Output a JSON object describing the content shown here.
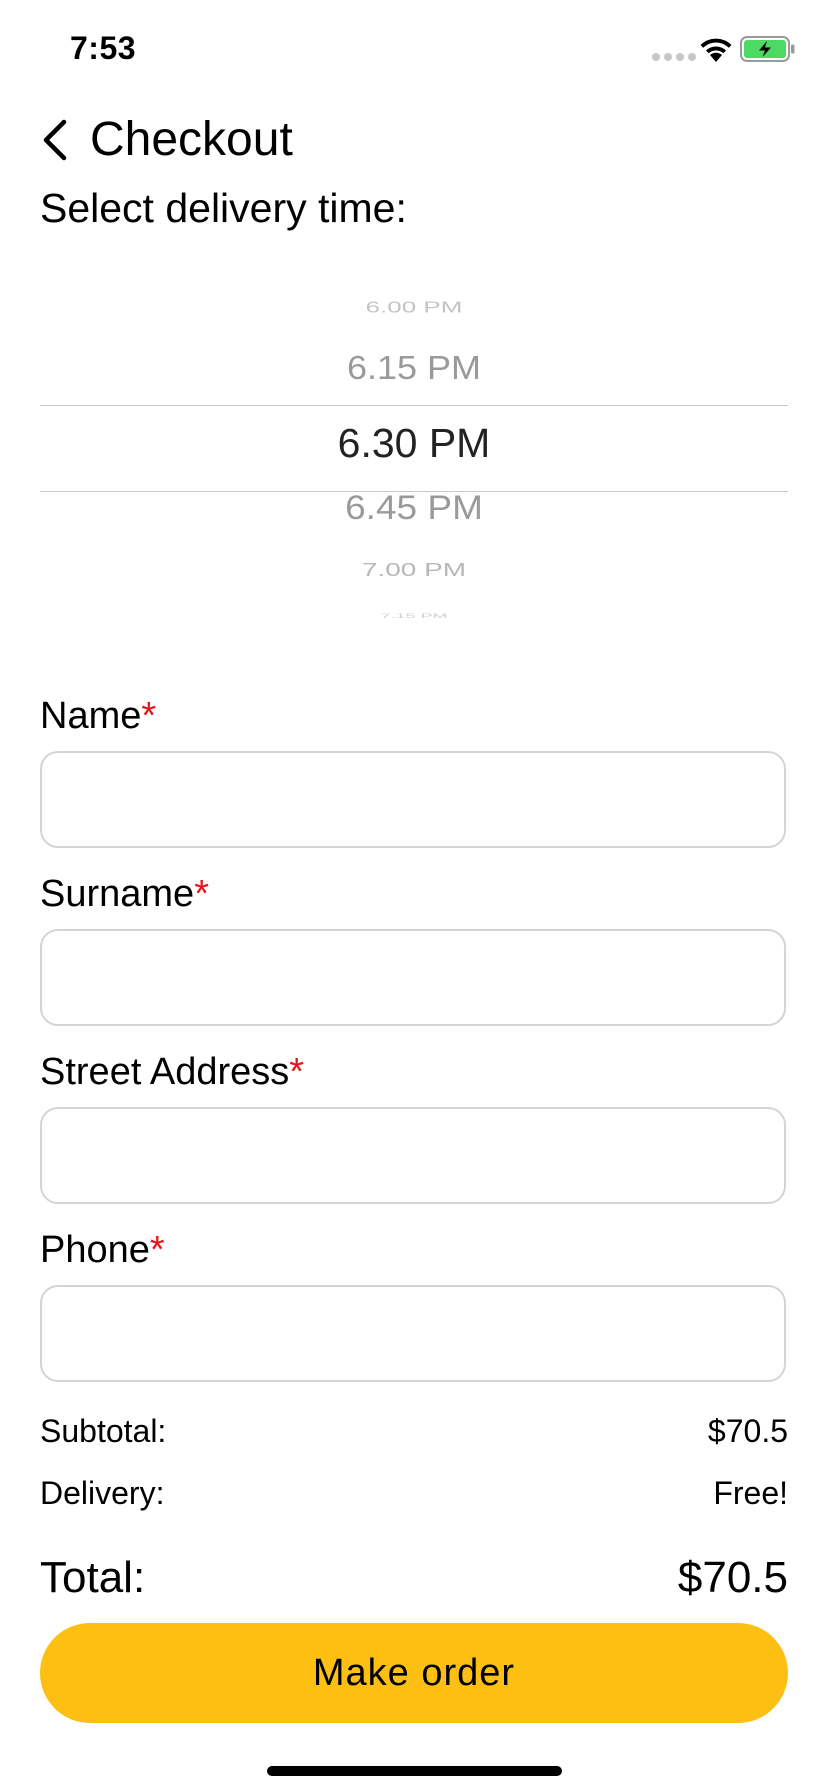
{
  "status_bar": {
    "time": "7:53"
  },
  "nav": {
    "title": "Checkout"
  },
  "delivery": {
    "label": "Select delivery time:",
    "options_visible": [
      "6.00 PM",
      "6.15 PM",
      "6.30 PM",
      "6.45 PM",
      "7.00 PM",
      "7.15 PM"
    ],
    "selected": "6.30 PM"
  },
  "form": {
    "required_mark": "*",
    "fields": [
      {
        "label": "Name",
        "value": ""
      },
      {
        "label": "Surname",
        "value": ""
      },
      {
        "label": "Street Address",
        "value": ""
      },
      {
        "label": "Phone",
        "value": ""
      }
    ]
  },
  "summary": {
    "subtotal_label": "Subtotal:",
    "subtotal_value": "$70.5",
    "delivery_label": "Delivery:",
    "delivery_value": "Free!",
    "total_label": "Total:",
    "total_value": "$70.5"
  },
  "actions": {
    "order_button": "Make order"
  },
  "colors": {
    "accent": "#fdbf12",
    "required": "#e8151b",
    "battery_fill": "#4cd964"
  }
}
